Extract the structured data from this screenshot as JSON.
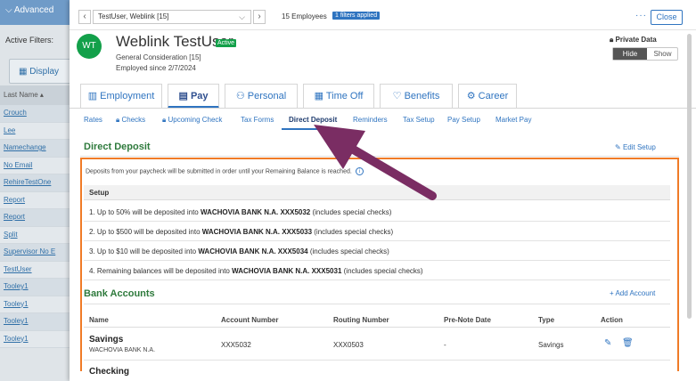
{
  "sidebar": {
    "advanced_label": "Advanced",
    "active_filters_label": "Active Filters:",
    "display_label": "Display",
    "last_name_header": "Last Name",
    "employees": [
      "Crouch",
      "Lee",
      "Namechange",
      "No Email",
      "RehireTestOne",
      "Report",
      "Report",
      "Split",
      "Supervisor No E",
      "TestUser",
      "Tooley1",
      "Tooley1",
      "Tooley1",
      "Tooley1"
    ]
  },
  "topbar": {
    "employee_select": "TestUser, Weblink [15]",
    "employee_count": "15 Employees",
    "filters_badge": "1 filters applied",
    "more": "···",
    "close_label": "Close"
  },
  "employee": {
    "initials": "WT",
    "name": "Weblink TestUser",
    "status": "Active",
    "line1": "General Consideration [15]",
    "line2": "Employed since 2/7/2024"
  },
  "private_data": {
    "title": "Private Data",
    "hide": "Hide",
    "show": "Show"
  },
  "main_tabs": [
    {
      "label": "Employment",
      "icon": "building-icon"
    },
    {
      "label": "Pay",
      "icon": "pay-icon"
    },
    {
      "label": "Personal",
      "icon": "person-icon"
    },
    {
      "label": "Time Off",
      "icon": "calendar-icon"
    },
    {
      "label": "Benefits",
      "icon": "heart-icon"
    },
    {
      "label": "Career",
      "icon": "career-icon"
    }
  ],
  "sub_tabs": [
    "Rates",
    "Checks",
    "Upcoming Check",
    "Tax Forms",
    "Direct Deposit",
    "Reminders",
    "Tax Setup",
    "Pay Setup",
    "Market Pay"
  ],
  "direct_deposit": {
    "title": "Direct Deposit",
    "edit_label": "Edit Setup",
    "note": "Deposits from your paycheck will be submitted in order until your Remaining Balance is reached.",
    "setup_header": "Setup",
    "rows": [
      {
        "pre": "1. Up to 50% will be deposited into ",
        "bold": "WACHOVIA BANK N.A. XXX5032",
        "post": " (includes special checks)"
      },
      {
        "pre": "2. Up to $500 will be deposited into ",
        "bold": "WACHOVIA BANK N.A. XXX5033",
        "post": " (includes special checks)"
      },
      {
        "pre": "3. Up to $10 will be deposited into ",
        "bold": "WACHOVIA BANK N.A. XXX5034",
        "post": " (includes special checks)"
      },
      {
        "pre": "4. Remaining balances will be deposited into ",
        "bold": "WACHOVIA BANK N.A. XXX5031",
        "post": " (includes special checks)"
      }
    ]
  },
  "bank_accounts": {
    "title": "Bank Accounts",
    "add_label": "Add Account",
    "headers": {
      "name": "Name",
      "account": "Account Number",
      "routing": "Routing Number",
      "prenote": "Pre-Note Date",
      "type": "Type",
      "action": "Action"
    },
    "rows": [
      {
        "name": "Savings",
        "bank": "WACHOVIA BANK N.A.",
        "account": "XXX5032",
        "routing": "XXX0503",
        "prenote": "-",
        "type": "Savings"
      },
      {
        "name": "Checking"
      }
    ]
  },
  "colors": {
    "accent": "#2f74c0",
    "green": "#13a04a",
    "section_title": "#2e7a3c",
    "highlight_box": "#f07b27",
    "arrow": "#7a2d63"
  }
}
